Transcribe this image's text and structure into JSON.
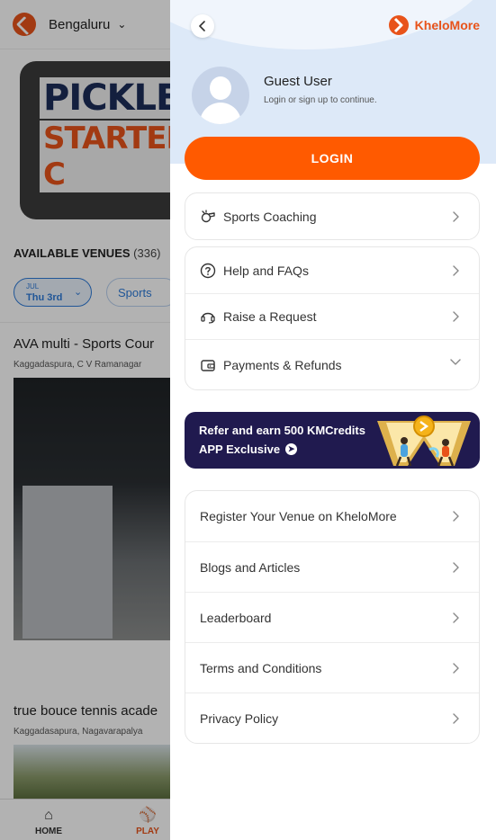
{
  "background": {
    "city": "Bengaluru",
    "banner_text_1": "PICKLEB",
    "banner_text_2": "STARTER C",
    "venues_title": "AVAILABLE VENUES",
    "venues_count": "(336)",
    "date_chip": {
      "month": "JUL",
      "day": "Thu 3rd"
    },
    "sports_chip": "Sports",
    "venue1": {
      "title": "AVA multi - Sports Cour",
      "location": "Kaggadaspura, C V Ramanagar"
    },
    "venue2": {
      "title": "true bouce tennis acade",
      "location": "Kaggadasapura, Nagavarapalya"
    },
    "nav": {
      "home": "HOME",
      "play": "PLAY"
    }
  },
  "drawer": {
    "brand": "KheloMore",
    "user": {
      "name": "Guest User",
      "subtitle": "Login or sign up to continue."
    },
    "login_label": "LOGIN",
    "section1": [
      {
        "label": "Sports Coaching",
        "icon": "whistle-icon"
      }
    ],
    "section2": [
      {
        "label": "Help and FAQs",
        "icon": "question-circle-icon"
      },
      {
        "label": "Raise a Request",
        "icon": "headset-icon"
      },
      {
        "label": "Payments & Refunds",
        "icon": "wallet-icon"
      }
    ],
    "refer": {
      "line1": "Refer and earn 500 KMCredits",
      "line2": "APP Exclusive"
    },
    "section3": [
      {
        "label": "Register Your Venue on KheloMore"
      },
      {
        "label": "Blogs and Articles"
      },
      {
        "label": "Leaderboard"
      },
      {
        "label": "Terms and Conditions"
      },
      {
        "label": "Privacy Policy"
      }
    ]
  },
  "colors": {
    "brand_orange": "#ff5a00",
    "refer_bg": "#201a4f",
    "header_bg": "#dde9f8"
  }
}
